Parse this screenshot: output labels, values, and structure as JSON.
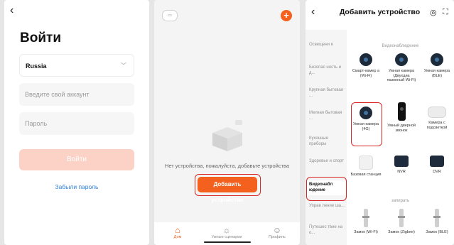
{
  "login": {
    "back": "‹",
    "title": "Войти",
    "country": "Russia",
    "chevron": "﹀",
    "account_placeholder": "Введите свой аккаунт",
    "password_placeholder": "Пароль",
    "login_button": "Войти",
    "forgot": "Забыли пароль"
  },
  "home": {
    "badge": "▭",
    "plus": "+",
    "empty_text": "Нет устройства, пожалуйста, добавьте устройства",
    "add_button": "Добавить устройство",
    "tabs": [
      {
        "icon": "⌂",
        "label": "Дом"
      },
      {
        "icon": "☼",
        "label": "Умные сценарии"
      },
      {
        "icon": "☺",
        "label": "Профиль"
      }
    ]
  },
  "add": {
    "back": "‹",
    "title": "Добавить устройство",
    "icon1": "◎",
    "icon2": "⛶",
    "categories": [
      "Освещени е",
      "Безопас ность и д...",
      "Крупная бытовая ...",
      "Мелкая бытовая ...",
      "Кухонные приборы",
      "Здоровье и спорт",
      "Видеонабл юдение",
      "Управ ление ша...",
      "Путешес твие на о..."
    ],
    "section1": "Видеонаблюдение",
    "devices": [
      "Смарт-камер а (Wi-Fi)",
      "Умная камера (Двухдиа пазонный Wi-Fi)",
      "Умная камера (BLE)",
      "Умная камера (4G)",
      "Умный дверной звонок",
      "Камера с подсветкой",
      "Базовая станция",
      "NVR",
      "DVR"
    ],
    "section2": "запирать",
    "locks": [
      "Замок (Wi-Fi)",
      "Замок (Zigbee)",
      "Замок (BLE)"
    ]
  },
  "colors": {
    "accent": "#f4611f",
    "highlight": "#d62626",
    "link": "#2e7fd9"
  }
}
